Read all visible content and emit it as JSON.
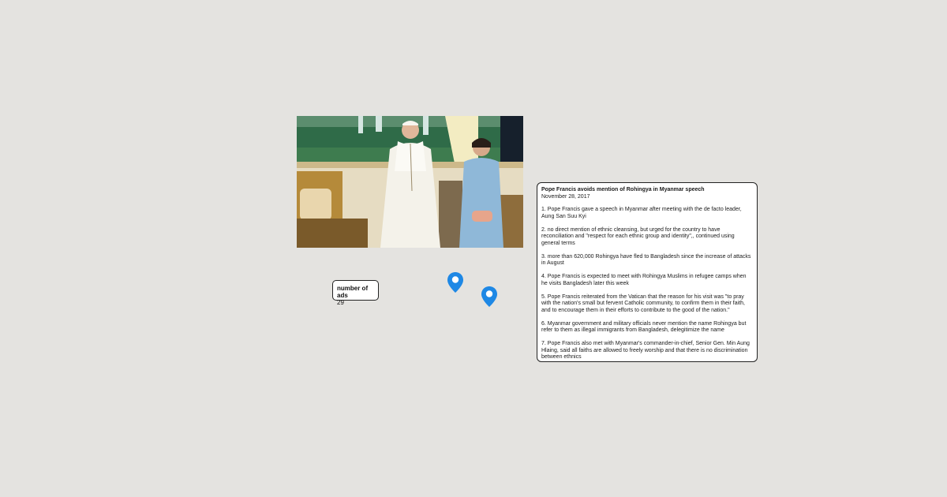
{
  "photo": {
    "alt": "Pope Francis and Aung San Suu Kyi standing side by side"
  },
  "ads_counter": {
    "label": "number of ads",
    "value": "29"
  },
  "map_pins": [
    {
      "icon": "map-pin-icon",
      "color": "#1e88e5"
    },
    {
      "icon": "map-pin-icon",
      "color": "#1e88e5"
    }
  ],
  "article": {
    "title": "Pope Francis avoids mention of Rohingya in Myanmar speech",
    "date": "November 28, 2017",
    "points": [
      "1. Pope Francis gave a speech in Myanmar after meeting with the de facto leader, Aung San Suu Kyi",
      "2. no direct mention of ethnic cleansing, but urged for the country to have reconciliation and \"respect for each ethnic group and identity\",, continued using general terms",
      "3. more than 620,000 Rohingya have fled to Bangladesh since the increase of attacks in August",
      "4. Pope Francis is expected to meet with Rohingya Muslims in refugee camps when he visits Bangladesh later this week",
      "5. Pope Francis reiterated from the Vatican that the reason for his visit was \"to pray with the nation's small but fervent Catholic community, to confirm them in their faith, and to encourage them in their efforts to contribute to the good of the nation.\"",
      "6. Myanmar government and military officials never mention the name Rohingya but refer to them as illegal immigrants from Bangladesh, delegitimize the name",
      "7. Pope Francis also met with Myanmar's commander-in-chief, Senior Gen. Min Aung Hlaing, said all faiths are allowed to freely worship and that there is no discrimination between ethnics"
    ]
  }
}
